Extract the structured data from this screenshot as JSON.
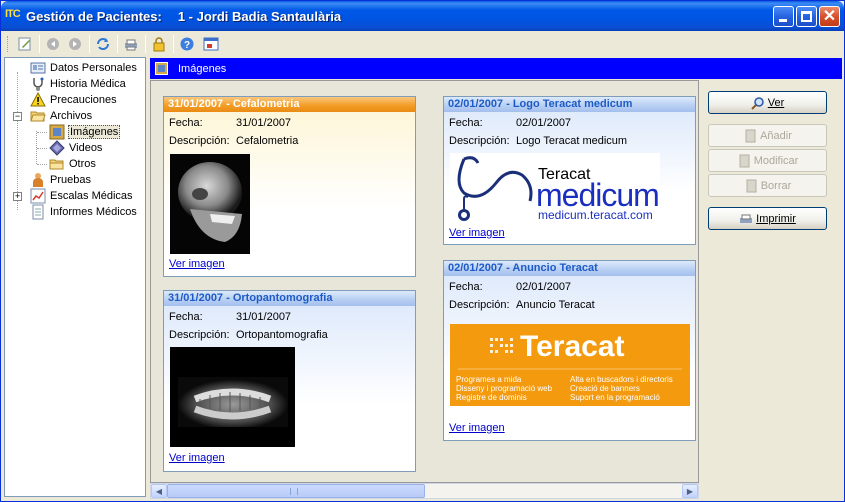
{
  "window": {
    "app_badge": "ITC",
    "title_prefix": "Gestión de Pacientes:",
    "patient": "1 - Jordi Badia Santaulària"
  },
  "tree": {
    "items": [
      {
        "label": "Datos Personales",
        "icon": "id-card-icon"
      },
      {
        "label": "Historia Médica",
        "icon": "stethoscope-icon"
      },
      {
        "label": "Precauciones",
        "icon": "warning-icon"
      },
      {
        "label": "Archivos",
        "icon": "folder-icon"
      },
      {
        "label": "Imágenes",
        "icon": "image-icon"
      },
      {
        "label": "Videos",
        "icon": "video-icon"
      },
      {
        "label": "Otros",
        "icon": "folder-icon"
      },
      {
        "label": "Pruebas",
        "icon": "person-icon"
      },
      {
        "label": "Escalas Médicas",
        "icon": "chart-icon"
      },
      {
        "label": "Informes Médicos",
        "icon": "document-icon"
      }
    ]
  },
  "section": {
    "title": "Imágenes"
  },
  "cards": [
    {
      "header": "31/01/2007 - Cefalometria",
      "fecha_label": "Fecha:",
      "fecha": "31/01/2007",
      "desc_label": "Descripción:",
      "desc": "Cefalometria",
      "link": "Ver imagen"
    },
    {
      "header": "31/01/2007 - Ortopantomografia",
      "fecha_label": "Fecha:",
      "fecha": "31/01/2007",
      "desc_label": "Descripción:",
      "desc": "Ortopantomografia",
      "link": "Ver imagen"
    },
    {
      "header": "02/01/2007 - Logo Teracat medicum",
      "fecha_label": "Fecha:",
      "fecha": "02/01/2007",
      "desc_label": "Descripción:",
      "desc": "Logo Teracat medicum",
      "link": "Ver imagen"
    },
    {
      "header": "02/01/2007 - Anuncio Teracat",
      "fecha_label": "Fecha:",
      "fecha": "02/01/2007",
      "desc_label": "Descripción:",
      "desc": "Anuncio Teracat",
      "link": "Ver imagen"
    }
  ],
  "logo": {
    "brand_small": "Teracat",
    "brand_big": "medicum",
    "url": "medicum.teracat.com"
  },
  "ad": {
    "brand": "Teracat",
    "lines_left": [
      "Programes a mida",
      "Disseny i programació web",
      "Registre de dominis"
    ],
    "lines_right": [
      "Alta en buscadors i directoris",
      "Creació de banners",
      "Suport en la programació"
    ]
  },
  "actions": {
    "ver": "Ver",
    "anadir": "Añadir",
    "modificar": "Modificar",
    "borrar": "Borrar",
    "imprimir": "Imprimir"
  }
}
